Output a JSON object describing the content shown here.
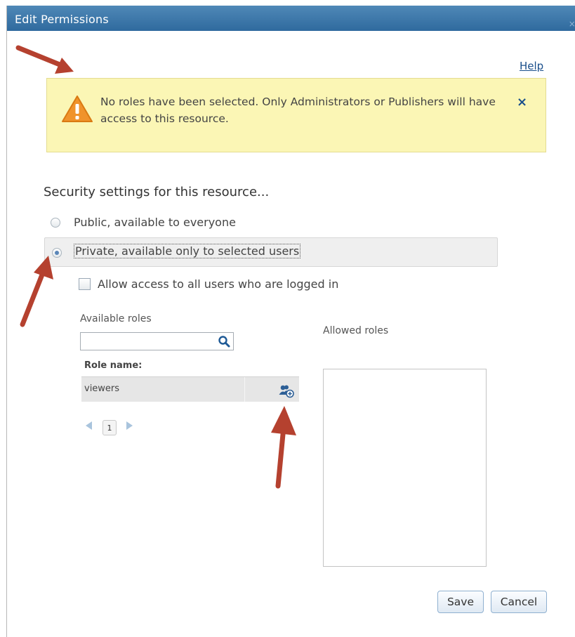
{
  "dialog": {
    "title": "Edit Permissions",
    "close_glyph": "×"
  },
  "help": {
    "label": "Help"
  },
  "alert": {
    "message": "No roles have been selected. Only Administrators or Publishers will have access to this resource.",
    "close_glyph": "×",
    "icon": "warning-icon"
  },
  "security": {
    "title": "Security settings for this resource...",
    "options": [
      {
        "label": "Public, available to everyone",
        "checked": false
      },
      {
        "label": "Private, available only to selected users",
        "checked": true
      }
    ],
    "allow_logged_in": {
      "label": "Allow access to all users who are logged in",
      "checked": false
    }
  },
  "available_roles": {
    "label": "Available roles",
    "search_value": "",
    "column_header": "Role name:",
    "rows": [
      {
        "name": "viewers",
        "action_icon": "add-role-icon"
      }
    ],
    "pager": {
      "current_page": "1"
    }
  },
  "allowed_roles": {
    "label": "Allowed roles",
    "items": []
  },
  "buttons": {
    "save": "Save",
    "cancel": "Cancel"
  },
  "colors": {
    "titlebar": "#3a76a8",
    "alert_bg": "#fbf6b5",
    "annotation_arrow": "#b5412f",
    "link": "#1a4f8b"
  }
}
